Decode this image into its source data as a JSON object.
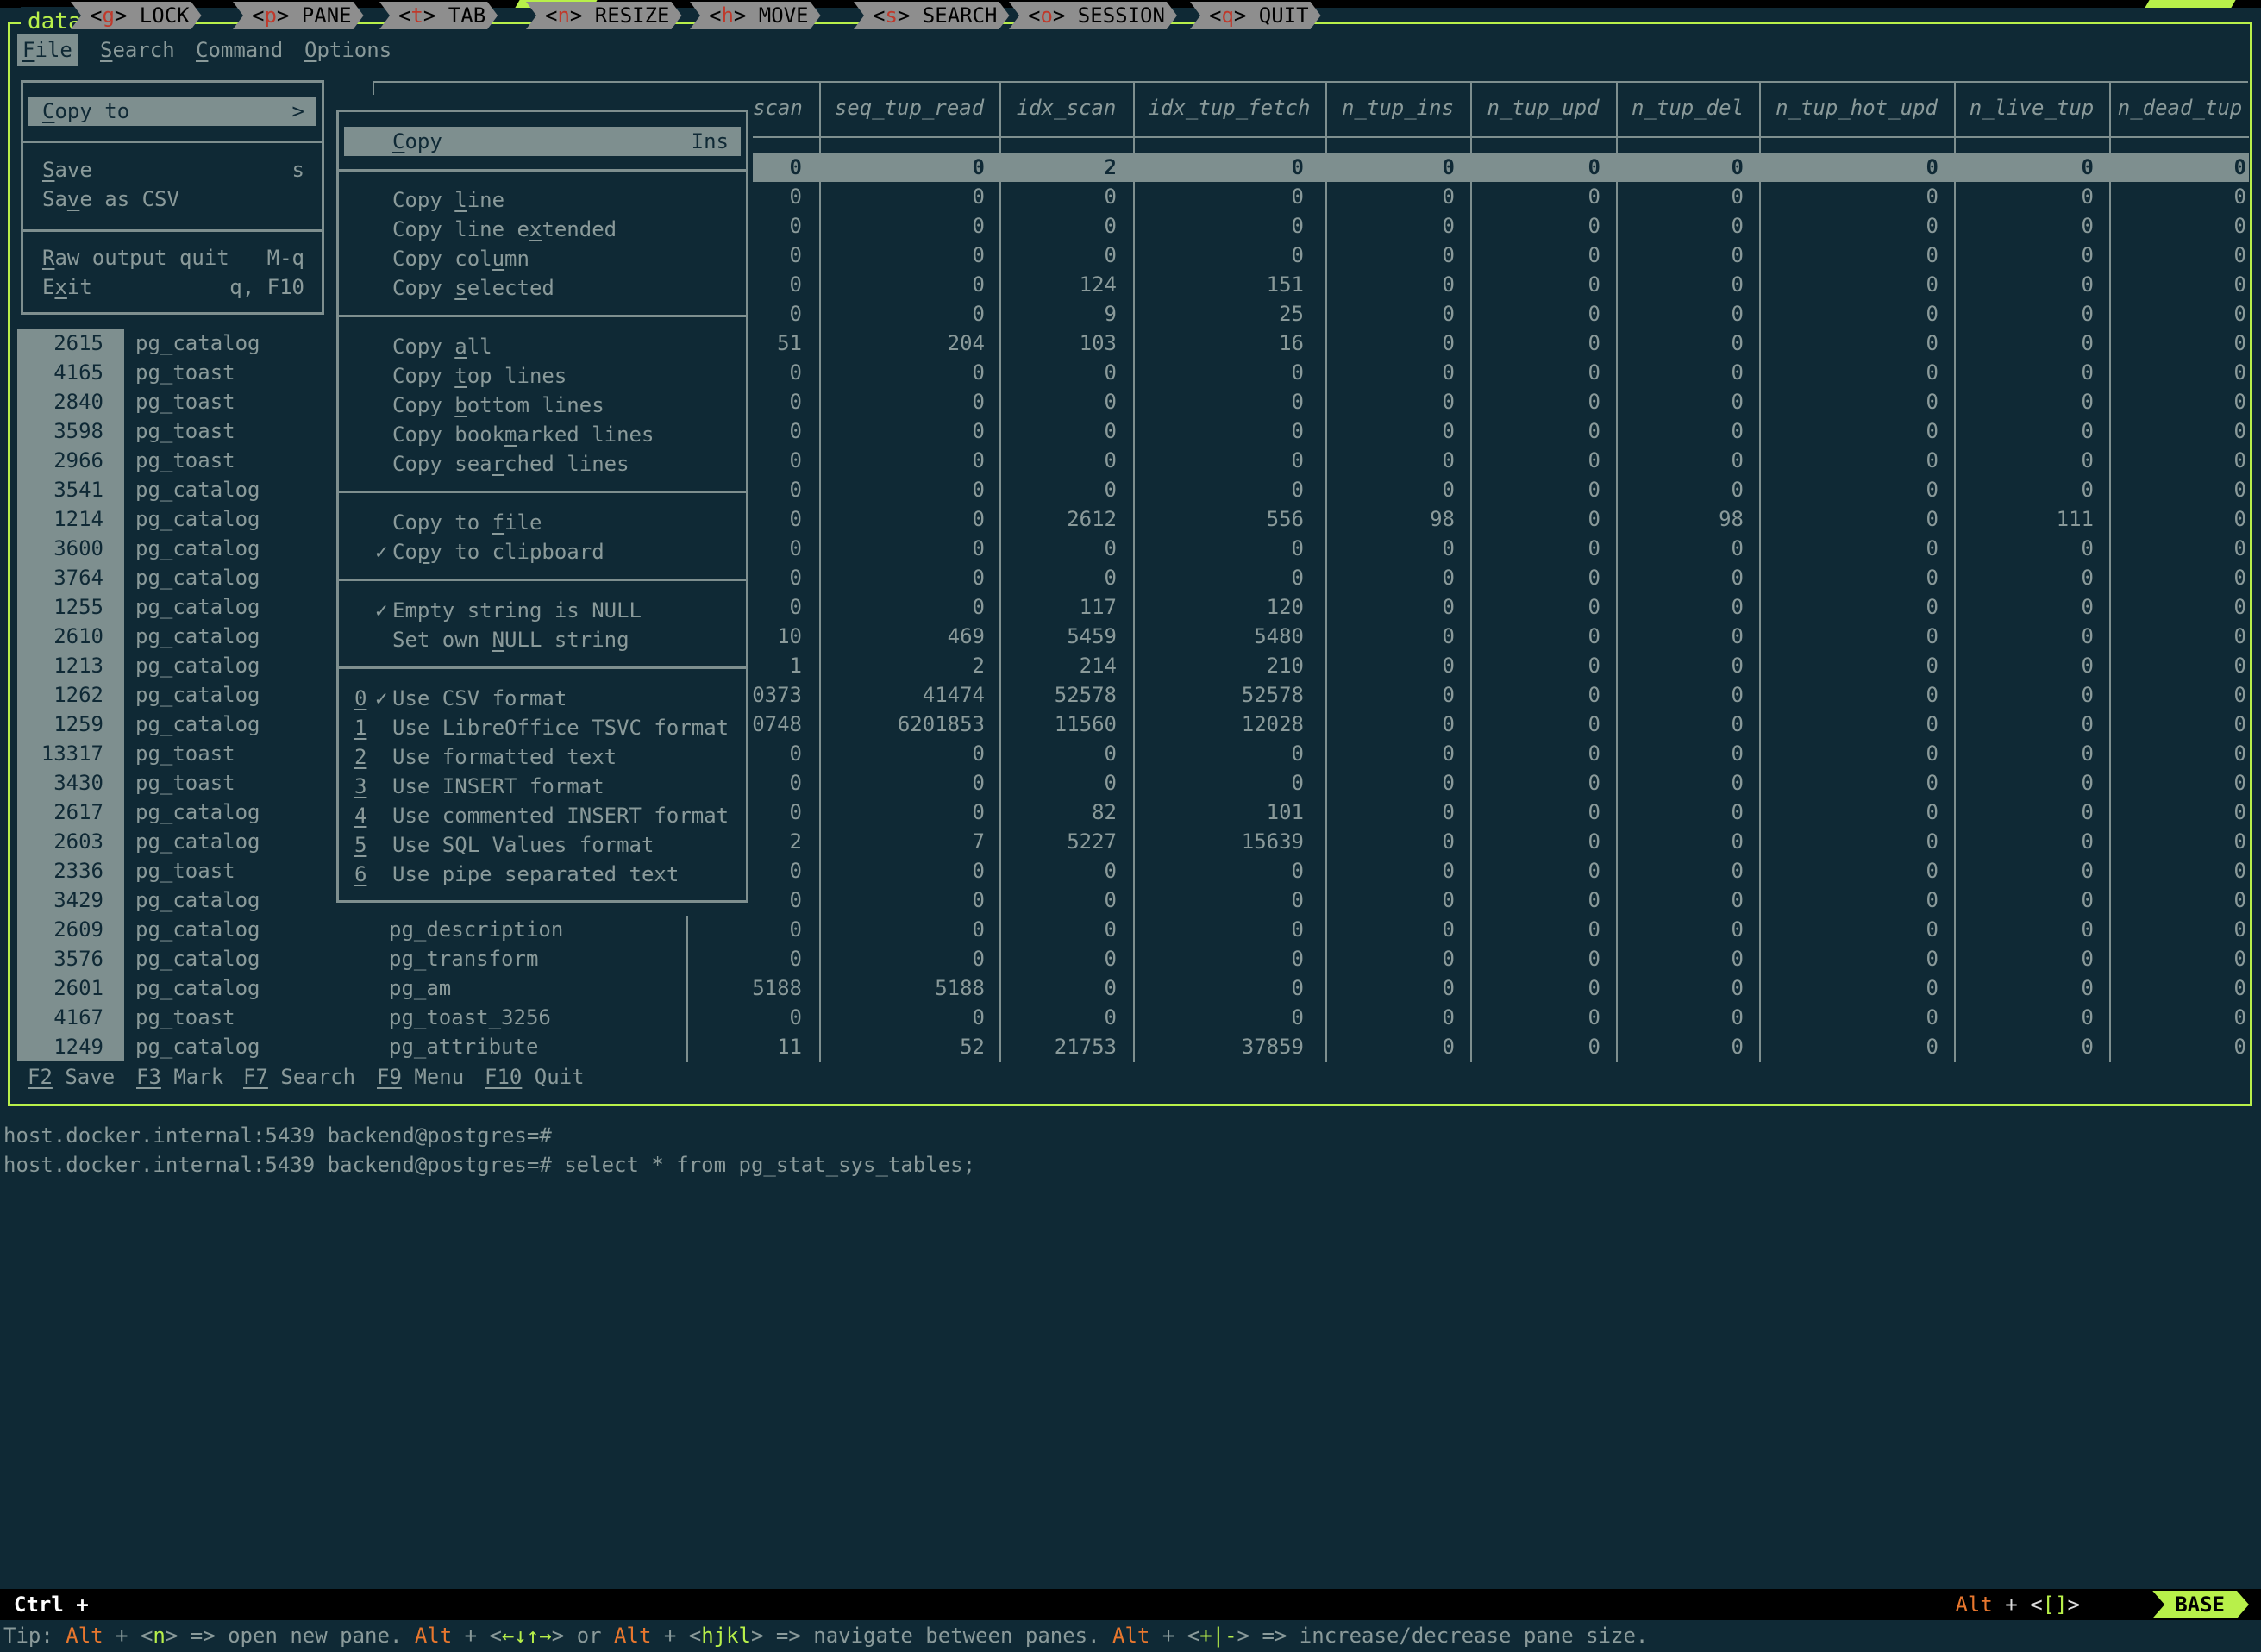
{
  "window": {
    "pane_title": "data"
  },
  "menubar": {
    "items": [
      {
        "label": "File",
        "underline": "F",
        "active": true
      },
      {
        "label": "Search",
        "underline": "S"
      },
      {
        "label": "Command",
        "underline": "C"
      },
      {
        "label": "Options",
        "underline": "O"
      }
    ]
  },
  "file_menu": {
    "items": [
      {
        "label": "Copy to",
        "shortcut": ">",
        "highlighted": true
      },
      {
        "label": "Save",
        "shortcut": "s"
      },
      {
        "label": "Save as CSV",
        "shortcut": ""
      },
      {
        "label": "Raw output quit",
        "shortcut": "M-q"
      },
      {
        "label": "Exit",
        "shortcut": "q, F10"
      }
    ]
  },
  "copy_menu": {
    "items": [
      {
        "label": "Copy",
        "shortcut": "Ins",
        "highlighted": true
      },
      {
        "label": "Copy line"
      },
      {
        "label": "Copy line extended"
      },
      {
        "label": "Copy column"
      },
      {
        "label": "Copy selected"
      },
      {
        "label": "Copy all"
      },
      {
        "label": "Copy top lines"
      },
      {
        "label": "Copy bottom lines"
      },
      {
        "label": "Copy bookmarked lines"
      },
      {
        "label": "Copy searched lines"
      },
      {
        "label": "Copy to file"
      },
      {
        "label": "Copy to clipboard",
        "checked": true
      },
      {
        "label": "Empty string is NULL",
        "checked": true
      },
      {
        "label": "Set own NULL string"
      },
      {
        "label": "Use CSV format",
        "num": "0",
        "checked": true
      },
      {
        "label": "Use LibreOffice TSVC format",
        "num": "1"
      },
      {
        "label": "Use formatted text",
        "num": "2"
      },
      {
        "label": "Use INSERT format",
        "num": "3"
      },
      {
        "label": "Use commented INSERT format",
        "num": "4"
      },
      {
        "label": "Use SQL Values format",
        "num": "5"
      },
      {
        "label": "Use pipe separated text",
        "num": "6"
      }
    ],
    "check_mark": "✓"
  },
  "table": {
    "columns": [
      "scan",
      "seq_tup_read",
      "idx_scan",
      "idx_tup_fetch",
      "n_tup_ins",
      "n_tup_upd",
      "n_tup_del",
      "n_tup_hot_upd",
      "n_live_tup",
      "n_dead_tup"
    ],
    "rows": [
      {
        "relid": "",
        "schema": "",
        "relname": "",
        "vals": [
          "0",
          "0",
          "2",
          "0",
          "0",
          "0",
          "0",
          "0",
          "0",
          "0"
        ],
        "selected": true
      },
      {
        "relid": "",
        "schema": "",
        "relname": "",
        "vals": [
          "0",
          "0",
          "0",
          "0",
          "0",
          "0",
          "0",
          "0",
          "0",
          "0"
        ]
      },
      {
        "relid": "",
        "schema": "",
        "relname": "",
        "vals": [
          "0",
          "0",
          "0",
          "0",
          "0",
          "0",
          "0",
          "0",
          "0",
          "0"
        ]
      },
      {
        "relid": "",
        "schema": "",
        "relname": "",
        "vals": [
          "0",
          "0",
          "0",
          "0",
          "0",
          "0",
          "0",
          "0",
          "0",
          "0"
        ]
      },
      {
        "relid": "",
        "schema": "",
        "relname": "",
        "vals": [
          "0",
          "0",
          "124",
          "151",
          "0",
          "0",
          "0",
          "0",
          "0",
          "0"
        ]
      },
      {
        "relid": "",
        "schema": "",
        "relname": "",
        "vals": [
          "0",
          "0",
          "9",
          "25",
          "0",
          "0",
          "0",
          "0",
          "0",
          "0"
        ]
      },
      {
        "relid": "2615",
        "schema": "pg_catalog",
        "relname": "",
        "vals": [
          "51",
          "204",
          "103",
          "16",
          "0",
          "0",
          "0",
          "0",
          "0",
          "0"
        ]
      },
      {
        "relid": "4165",
        "schema": "pg_toast",
        "relname": "",
        "vals": [
          "0",
          "0",
          "0",
          "0",
          "0",
          "0",
          "0",
          "0",
          "0",
          "0"
        ]
      },
      {
        "relid": "2840",
        "schema": "pg_toast",
        "relname": "",
        "vals": [
          "0",
          "0",
          "0",
          "0",
          "0",
          "0",
          "0",
          "0",
          "0",
          "0"
        ]
      },
      {
        "relid": "3598",
        "schema": "pg_toast",
        "relname": "",
        "vals": [
          "0",
          "0",
          "0",
          "0",
          "0",
          "0",
          "0",
          "0",
          "0",
          "0"
        ]
      },
      {
        "relid": "2966",
        "schema": "pg_toast",
        "relname": "",
        "vals": [
          "0",
          "0",
          "0",
          "0",
          "0",
          "0",
          "0",
          "0",
          "0",
          "0"
        ]
      },
      {
        "relid": "3541",
        "schema": "pg_catalog",
        "relname": "",
        "vals": [
          "0",
          "0",
          "0",
          "0",
          "0",
          "0",
          "0",
          "0",
          "0",
          "0"
        ]
      },
      {
        "relid": "1214",
        "schema": "pg_catalog",
        "relname": "",
        "vals": [
          "0",
          "0",
          "2612",
          "556",
          "98",
          "0",
          "98",
          "0",
          "111",
          "0"
        ]
      },
      {
        "relid": "3600",
        "schema": "pg_catalog",
        "relname": "",
        "vals": [
          "0",
          "0",
          "0",
          "0",
          "0",
          "0",
          "0",
          "0",
          "0",
          "0"
        ]
      },
      {
        "relid": "3764",
        "schema": "pg_catalog",
        "relname": "",
        "vals": [
          "0",
          "0",
          "0",
          "0",
          "0",
          "0",
          "0",
          "0",
          "0",
          "0"
        ]
      },
      {
        "relid": "1255",
        "schema": "pg_catalog",
        "relname": "",
        "vals": [
          "0",
          "0",
          "117",
          "120",
          "0",
          "0",
          "0",
          "0",
          "0",
          "0"
        ]
      },
      {
        "relid": "2610",
        "schema": "pg_catalog",
        "relname": "",
        "vals": [
          "10",
          "469",
          "5459",
          "5480",
          "0",
          "0",
          "0",
          "0",
          "0",
          "0"
        ]
      },
      {
        "relid": "1213",
        "schema": "pg_catalog",
        "relname": "",
        "vals": [
          "1",
          "2",
          "214",
          "210",
          "0",
          "0",
          "0",
          "0",
          "0",
          "0"
        ]
      },
      {
        "relid": "1262",
        "schema": "pg_catalog",
        "relname": "",
        "vals": [
          "0373",
          "41474",
          "52578",
          "52578",
          "0",
          "0",
          "0",
          "0",
          "0",
          "0"
        ]
      },
      {
        "relid": "1259",
        "schema": "pg_catalog",
        "relname": "",
        "vals": [
          "0748",
          "6201853",
          "11560",
          "12028",
          "0",
          "0",
          "0",
          "0",
          "0",
          "0"
        ]
      },
      {
        "relid": "13317",
        "schema": "pg_toast",
        "relname": "",
        "vals": [
          "0",
          "0",
          "0",
          "0",
          "0",
          "0",
          "0",
          "0",
          "0",
          "0"
        ]
      },
      {
        "relid": "3430",
        "schema": "pg_toast",
        "relname": "",
        "vals": [
          "0",
          "0",
          "0",
          "0",
          "0",
          "0",
          "0",
          "0",
          "0",
          "0"
        ]
      },
      {
        "relid": "2617",
        "schema": "pg_catalog",
        "relname": "",
        "vals": [
          "0",
          "0",
          "82",
          "101",
          "0",
          "0",
          "0",
          "0",
          "0",
          "0"
        ]
      },
      {
        "relid": "2603",
        "schema": "pg_catalog",
        "relname": "",
        "vals": [
          "2",
          "7",
          "5227",
          "15639",
          "0",
          "0",
          "0",
          "0",
          "0",
          "0"
        ]
      },
      {
        "relid": "2336",
        "schema": "pg_toast",
        "relname": "",
        "vals": [
          "0",
          "0",
          "0",
          "0",
          "0",
          "0",
          "0",
          "0",
          "0",
          "0"
        ]
      },
      {
        "relid": "3429",
        "schema": "pg_catalog",
        "relname": "",
        "vals": [
          "0",
          "0",
          "0",
          "0",
          "0",
          "0",
          "0",
          "0",
          "0",
          "0"
        ]
      },
      {
        "relid": "2609",
        "schema": "pg_catalog",
        "relname": "pg_description",
        "vals": [
          "0",
          "0",
          "0",
          "0",
          "0",
          "0",
          "0",
          "0",
          "0",
          "0"
        ]
      },
      {
        "relid": "3576",
        "schema": "pg_catalog",
        "relname": "pg_transform",
        "vals": [
          "0",
          "0",
          "0",
          "0",
          "0",
          "0",
          "0",
          "0",
          "0",
          "0"
        ]
      },
      {
        "relid": "2601",
        "schema": "pg_catalog",
        "relname": "pg_am",
        "vals": [
          "5188",
          "5188",
          "0",
          "0",
          "0",
          "0",
          "0",
          "0",
          "0",
          "0"
        ]
      },
      {
        "relid": "4167",
        "schema": "pg_toast",
        "relname": "pg_toast_3256",
        "vals": [
          "0",
          "0",
          "0",
          "0",
          "0",
          "0",
          "0",
          "0",
          "0",
          "0"
        ]
      },
      {
        "relid": "1249",
        "schema": "pg_catalog",
        "relname": "pg_attribute",
        "vals": [
          "11",
          "52",
          "21753",
          "37859",
          "0",
          "0",
          "0",
          "0",
          "0",
          "0"
        ]
      }
    ]
  },
  "fkeys": [
    {
      "key": "F2",
      "label": "Save"
    },
    {
      "key": "F3",
      "label": "Mark"
    },
    {
      "key": "F7",
      "label": "Search"
    },
    {
      "key": "F9",
      "label": "Menu"
    },
    {
      "key": "F10",
      "label": "Quit"
    }
  ],
  "terminal": {
    "lines": [
      "host.docker.internal:5439 backend@postgres=#",
      "host.docker.internal:5439 backend@postgres=# select * from pg_stat_sys_tables;"
    ]
  },
  "zellij": {
    "ctrl_label": "Ctrl +",
    "modes": [
      {
        "key": "g",
        "label": "LOCK"
      },
      {
        "key": "p",
        "label": "PANE"
      },
      {
        "key": "t",
        "label": "TAB"
      },
      {
        "key": "n",
        "label": "RESIZE"
      },
      {
        "key": "h",
        "label": "MOVE"
      },
      {
        "key": "s",
        "label": "SEARCH"
      },
      {
        "key": "o",
        "label": "SESSION"
      },
      {
        "key": "q",
        "label": "QUIT"
      }
    ],
    "right_alt": "Alt",
    "right_plus": " + <",
    "right_glyph": "[]",
    "right_close": ">",
    "mode_badge": "BASE",
    "tip": {
      "prefix": "Tip: ",
      "parts": [
        {
          "t": "Alt",
          "c": "orange"
        },
        {
          "t": " + <",
          "c": ""
        },
        {
          "t": "n",
          "c": "lime"
        },
        {
          "t": "> => open new pane. ",
          "c": ""
        },
        {
          "t": "Alt",
          "c": "orange"
        },
        {
          "t": " + <",
          "c": ""
        },
        {
          "t": "←↓↑→",
          "c": "lime"
        },
        {
          "t": "> or ",
          "c": ""
        },
        {
          "t": "Alt",
          "c": "orange"
        },
        {
          "t": " + <",
          "c": ""
        },
        {
          "t": "hjkl",
          "c": "lime"
        },
        {
          "t": "> => navigate between panes. ",
          "c": ""
        },
        {
          "t": "Alt",
          "c": "orange"
        },
        {
          "t": " + <",
          "c": ""
        },
        {
          "t": "+|-",
          "c": "lime"
        },
        {
          "t": "> => increase/decrease pane size.",
          "c": ""
        }
      ]
    }
  },
  "colors": {
    "background": "#0f2935",
    "accent": "#b8f04a",
    "menu_highlight": "#7e8f8f",
    "text": "#8a9a9a",
    "alt_key": "#e8772e"
  }
}
